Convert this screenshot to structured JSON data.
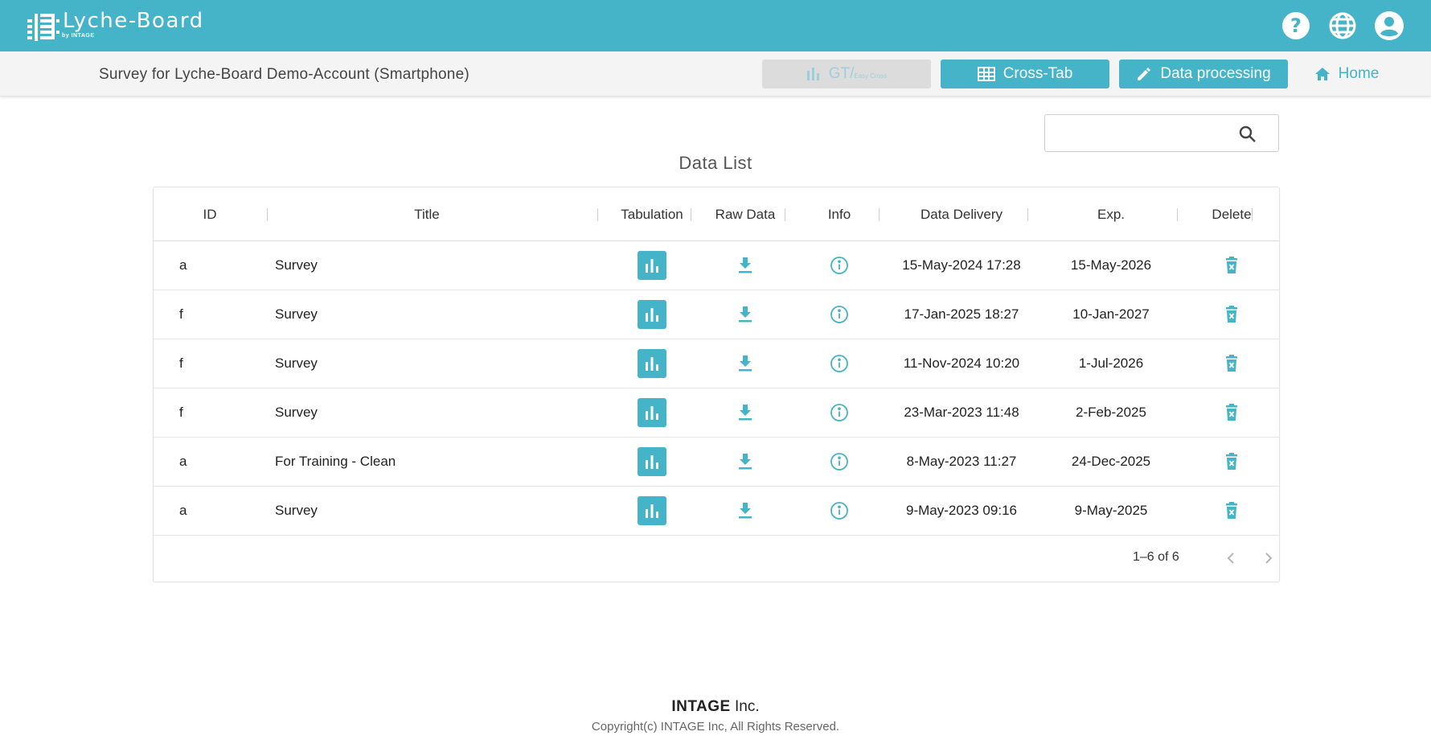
{
  "app": {
    "logo_text": "Lyche-Board",
    "logo_sub": "by INTAGE",
    "icons": [
      "help-icon",
      "globe-icon",
      "account-icon"
    ]
  },
  "subheader": {
    "survey_title": "Survey for Lyche-Board Demo-Account (Smartphone)",
    "gt_label": "GT/",
    "gt_sub": "Easy Cross",
    "crosstab_label": "Cross-Tab",
    "processing_label": "Data processing",
    "home_label": "Home"
  },
  "search": {
    "placeholder": "",
    "value": ""
  },
  "list": {
    "title": "Data List",
    "columns": {
      "id": "ID",
      "title": "Title",
      "tabulation": "Tabulation",
      "raw": "Raw Data",
      "info": "Info",
      "delivery": "Data Delivery",
      "exp": "Exp.",
      "delete": "Delete"
    },
    "rows": [
      {
        "id": "a",
        "title": "Survey",
        "delivery": "15-May-2024 17:28",
        "exp": "15-May-2026"
      },
      {
        "id": "f",
        "title": "Survey",
        "delivery": "17-Jan-2025 18:27",
        "exp": "10-Jan-2027"
      },
      {
        "id": "f",
        "title": "Survey",
        "delivery": "11-Nov-2024 10:20",
        "exp": "1-Jul-2026"
      },
      {
        "id": "f",
        "title": "Survey",
        "delivery": "23-Mar-2023 11:48",
        "exp": "2-Feb-2025"
      },
      {
        "id": "a",
        "title": "For Training - Clean",
        "delivery": "8-May-2023 11:27",
        "exp": "24-Dec-2025"
      },
      {
        "id": "a",
        "title": "Survey",
        "delivery": "9-May-2023 09:16",
        "exp": "9-May-2025"
      }
    ],
    "pagination": "1–6 of 6"
  },
  "footer": {
    "brand_bold": "INTAGE",
    "brand_rest": " Inc.",
    "copyright": "Copyright(c) INTAGE Inc, All Rights Reserved."
  },
  "colors": {
    "accent": "#45b3c8",
    "header_bg": "#45b3c8",
    "subheader_bg": "#f4f4f4"
  }
}
